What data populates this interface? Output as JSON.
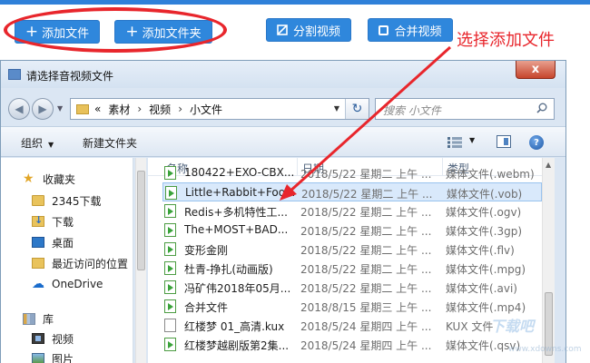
{
  "app_toolbar": {
    "add_file": "添加文件",
    "add_folder": "添加文件夹",
    "split_video": "分割视频",
    "merge_video": "合并视频"
  },
  "annotation": {
    "label": "选择添加文件",
    "color": "#e8262c"
  },
  "dialog": {
    "title": "请选择音视频文件",
    "close_symbol": "x",
    "address": {
      "overflow": "«",
      "segments": [
        "素材",
        "视频",
        "小文件"
      ]
    },
    "search": {
      "placeholder": "搜索 小文件"
    },
    "commands": {
      "organize": "组织",
      "new_folder": "新建文件夹"
    },
    "nav_pane": {
      "favorites_label": "收藏夹",
      "favorites": [
        {
          "label": "2345下载",
          "icon": "folder-icon"
        },
        {
          "label": "下载",
          "icon": "downloads-icon"
        },
        {
          "label": "桌面",
          "icon": "desktop-icon"
        },
        {
          "label": "最近访问的位置",
          "icon": "recent-places-icon"
        }
      ],
      "onedrive": "OneDrive",
      "library_label": "库",
      "library": [
        {
          "label": "视频",
          "icon": "videos-library-icon"
        },
        {
          "label": "图片",
          "icon": "pictures-library-icon"
        }
      ]
    },
    "columns": {
      "name": "名称",
      "date": "日期",
      "type": "类型"
    },
    "files": [
      {
        "name": "180422+EXO-CBX...",
        "date": "2018/5/22 星期二 上午 ...",
        "type": "媒体文件(.webm)",
        "selected": false,
        "icon": "media-file-icon"
      },
      {
        "name": "Little+Rabbit+Foo...",
        "date": "2018/5/22 星期二 上午 ...",
        "type": "媒体文件(.vob)",
        "selected": true,
        "icon": "media-file-icon"
      },
      {
        "name": "Redis+多机特性工...",
        "date": "2018/5/22 星期二 上午 ...",
        "type": "媒体文件(.ogv)",
        "selected": false,
        "icon": "media-file-icon"
      },
      {
        "name": "The+MOST+BAD...",
        "date": "2018/5/22 星期二 上午 ...",
        "type": "媒体文件(.3gp)",
        "selected": false,
        "icon": "media-file-icon"
      },
      {
        "name": "变形金刚",
        "date": "2018/5/22 星期二 上午 ...",
        "type": "媒体文件(.flv)",
        "selected": false,
        "icon": "media-file-icon"
      },
      {
        "name": "杜青-挣扎(动画版)",
        "date": "2018/5/22 星期二 上午 ...",
        "type": "媒体文件(.mpg)",
        "selected": false,
        "icon": "media-file-icon"
      },
      {
        "name": "冯矿伟2018年05月...",
        "date": "2018/5/22 星期二 上午 ...",
        "type": "媒体文件(.avi)",
        "selected": false,
        "icon": "media-file-icon"
      },
      {
        "name": "合并文件",
        "date": "2018/8/15 星期三 上午 ...",
        "type": "媒体文件(.mp4)",
        "selected": false,
        "icon": "media-file-icon"
      },
      {
        "name": "红楼梦 01_高清.kux",
        "date": "2018/5/24 星期四 上午 ...",
        "type": "KUX 文件",
        "selected": false,
        "icon": "document-icon"
      },
      {
        "name": "红楼梦越剧版第2集...",
        "date": "2018/5/24 星期四 上午 ...",
        "type": "媒体文件(.qsv)",
        "selected": false,
        "icon": "media-file-icon"
      }
    ]
  },
  "watermark": {
    "brand": "下载吧",
    "url": "www.xdowns.com"
  }
}
